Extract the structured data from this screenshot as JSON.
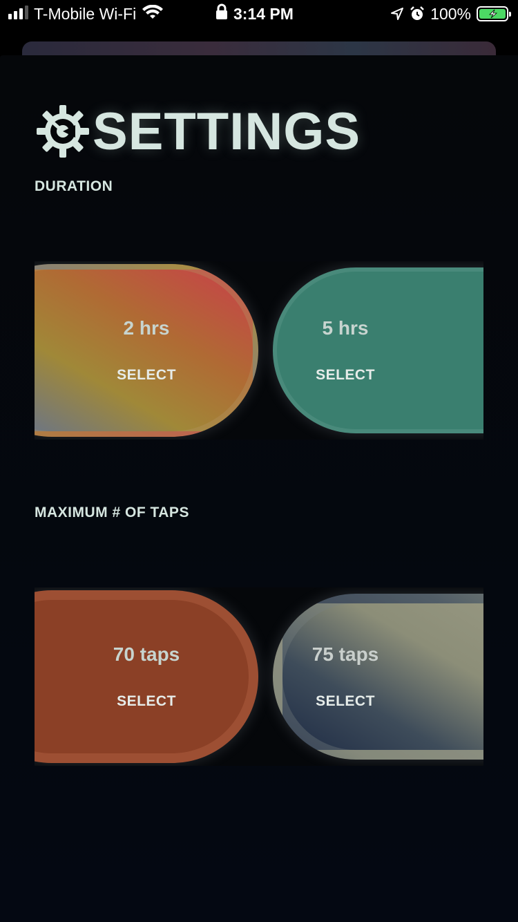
{
  "status_bar": {
    "carrier": "T-Mobile Wi-Fi",
    "time": "3:14 PM",
    "battery": "100%",
    "icons": [
      "signal-icon",
      "wifi-icon",
      "lock-icon",
      "location-icon",
      "alarm-icon",
      "battery-charging-icon"
    ]
  },
  "page": {
    "title": "SETTINGS",
    "title_icon": "gear-icon"
  },
  "duration": {
    "label": "DURATION",
    "options": [
      {
        "value": "2 hrs",
        "action": "SELECT"
      },
      {
        "value": "5 hrs",
        "action": "SELECT"
      }
    ]
  },
  "taps": {
    "label": "MAXIMUM # OF TAPS",
    "options": [
      {
        "value": "70 taps",
        "action": "SELECT"
      },
      {
        "value": "75 taps",
        "action": "SELECT"
      }
    ]
  },
  "colors": {
    "background": "#000000",
    "title": "#d6e6e0",
    "teal_option": "#3a7f6f",
    "rust_option": "#8b4026",
    "battery_green": "#4cd964"
  }
}
